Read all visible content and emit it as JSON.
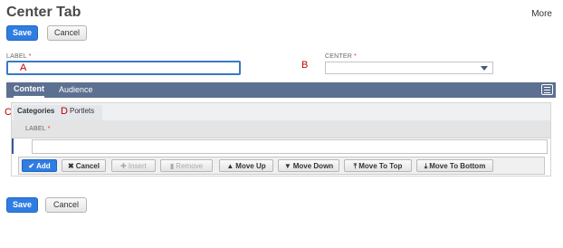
{
  "page": {
    "title": "Center Tab",
    "more_label": "More"
  },
  "top_actions": {
    "save_label": "Save",
    "cancel_label": "Cancel"
  },
  "bottom_actions": {
    "save_label": "Save",
    "cancel_label": "Cancel"
  },
  "form": {
    "label_field": {
      "label": "LABEL",
      "required_mark": "*",
      "value": ""
    },
    "center_field": {
      "label": "CENTER",
      "required_mark": "*",
      "value": ""
    }
  },
  "annotations": {
    "a": "A",
    "b": "B",
    "c": "C",
    "d": "D"
  },
  "tabs": [
    {
      "label": "Content",
      "active": true
    },
    {
      "label": "Audience",
      "active": false
    }
  ],
  "subtabs": [
    {
      "label": "Categories",
      "active": true
    },
    {
      "label": "Portlets",
      "active": false
    }
  ],
  "grid": {
    "column_label": "LABEL",
    "required_mark": "*",
    "row_value": ""
  },
  "toolbar": {
    "buttons": [
      {
        "label": "Add",
        "icon": "check-icon",
        "enabled": true
      },
      {
        "label": "Cancel",
        "icon": "x-icon",
        "enabled": true
      },
      {
        "label": "Insert",
        "icon": "plus-icon",
        "enabled": false
      },
      {
        "label": "Remove",
        "icon": "trash-icon",
        "enabled": false
      },
      {
        "label": "Move Up",
        "icon": "arrow-up-icon",
        "enabled": true
      },
      {
        "label": "Move Down",
        "icon": "arrow-down-icon",
        "enabled": true
      },
      {
        "label": "Move To Top",
        "icon": "arrow-top-icon",
        "enabled": true
      },
      {
        "label": "Move To Bottom",
        "icon": "arrow-bottom-icon",
        "enabled": true
      }
    ]
  },
  "colors": {
    "accent": "#2f7de1",
    "tabbar": "#5c7091",
    "annotation": "#c00000"
  }
}
